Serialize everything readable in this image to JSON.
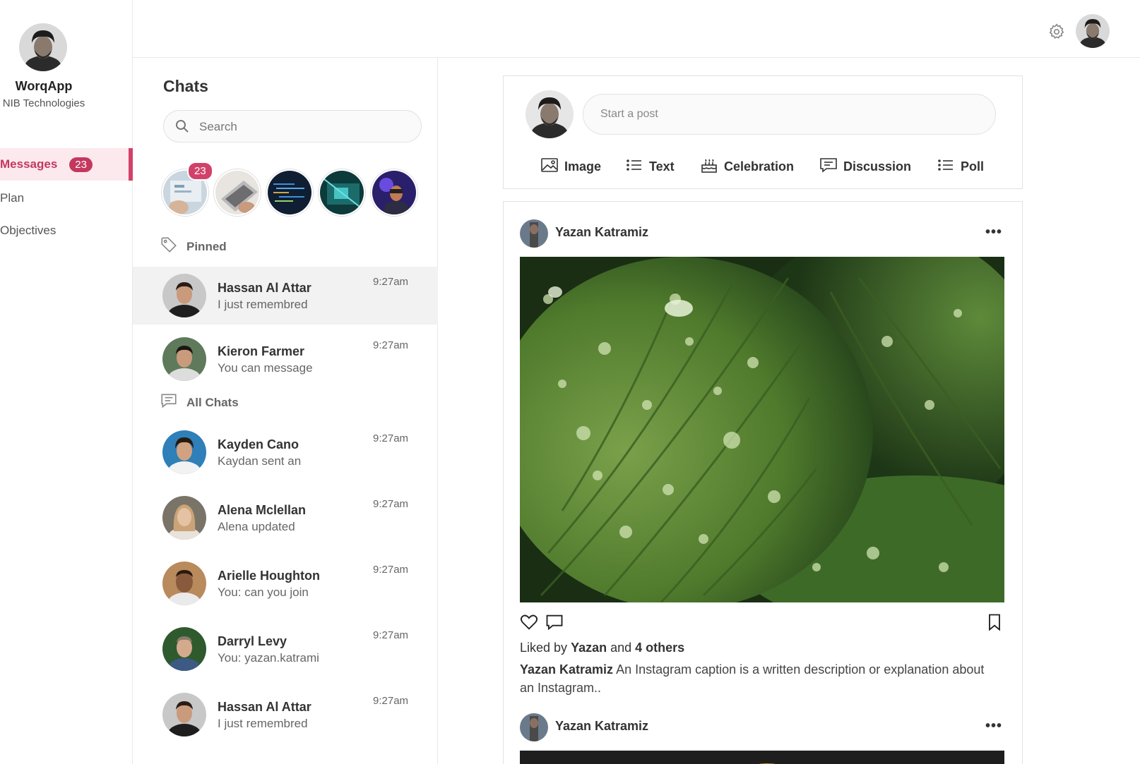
{
  "brand": {
    "name": "WorqApp",
    "org": "NIB Technologies"
  },
  "nav": {
    "items": [
      {
        "label": "Messages",
        "badge": "23"
      },
      {
        "label": "Plan"
      },
      {
        "label": "Objectives"
      }
    ]
  },
  "chats": {
    "title": "Chats",
    "search_placeholder": "Search",
    "story_badge": "23",
    "pinned_label": "Pinned",
    "all_label": "All Chats",
    "pinned": [
      {
        "name": "Hassan Al Attar",
        "message": "I just remembred",
        "time": "9:27am"
      },
      {
        "name": "Kieron Farmer",
        "message": "You can message",
        "time": "9:27am"
      }
    ],
    "all": [
      {
        "name": "Kayden Cano",
        "message": "Kaydan sent an",
        "time": "9:27am"
      },
      {
        "name": "Alena Mclellan",
        "message": "Alena updated",
        "time": "9:27am"
      },
      {
        "name": "Arielle Houghton",
        "message": "You: can you join",
        "time": "9:27am"
      },
      {
        "name": "Darryl Levy",
        "message": "You: yazan.katrami",
        "time": "9:27am"
      },
      {
        "name": "Hassan Al Attar",
        "message": "I just remembred",
        "time": "9:27am"
      }
    ]
  },
  "composer": {
    "placeholder": "Start a post",
    "actions": [
      "Image",
      "Text",
      "Celebration",
      "Discussion",
      "Poll"
    ]
  },
  "post": {
    "author": "Yazan Katramiz",
    "likes_prefix": "Liked by",
    "likes_user": "Yazan",
    "likes_and": "and",
    "likes_others": "4 others",
    "caption_author": "Yazan Katramiz",
    "caption_text": "An Instagram caption is a written description or explanation about an Instagram.."
  },
  "post2": {
    "author": "Yazan Katramiz"
  },
  "colors": {
    "accent": "#c4385e",
    "accent_bg": "#fbe9ee",
    "border": "#e2e2e2"
  }
}
